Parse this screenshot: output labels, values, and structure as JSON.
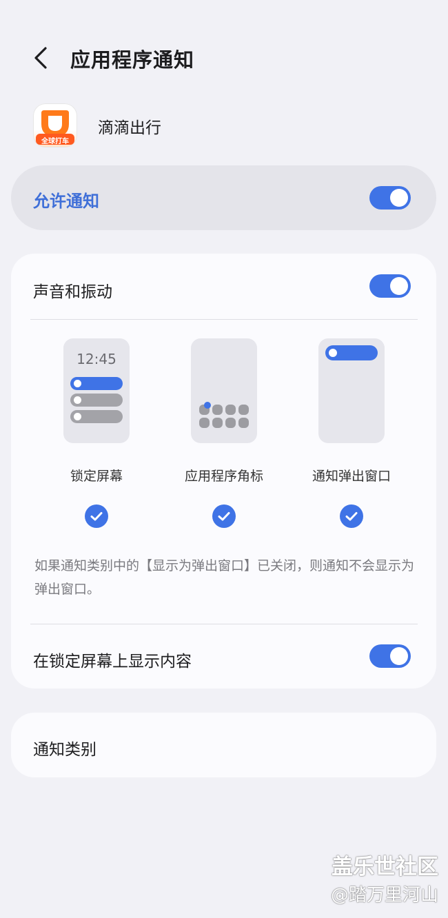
{
  "header": {
    "title": "应用程序通知"
  },
  "app": {
    "name": "滴滴出行",
    "icon_badge": "全球打车"
  },
  "allow": {
    "label": "允许通知",
    "enabled": true
  },
  "sound": {
    "label": "声音和振动",
    "enabled": true
  },
  "options": [
    {
      "label": "锁定屏幕",
      "checked": true,
      "preview_time": "12:45"
    },
    {
      "label": "应用程序角标",
      "checked": true
    },
    {
      "label": "通知弹出窗口",
      "checked": true
    }
  ],
  "description": "如果通知类别中的【显示为弹出窗口】已关闭，则通知不会显示为弹出窗口。",
  "lockscreen_content": {
    "label": "在锁定屏幕上显示内容",
    "enabled": true
  },
  "categories": {
    "label": "通知类别"
  },
  "watermark": {
    "line1": "盖乐世社区",
    "line2": "@踏万里河山"
  },
  "colors": {
    "accent": "#3f73e6",
    "accent_text": "#3f6fd8",
    "background": "#f1f1f6"
  }
}
